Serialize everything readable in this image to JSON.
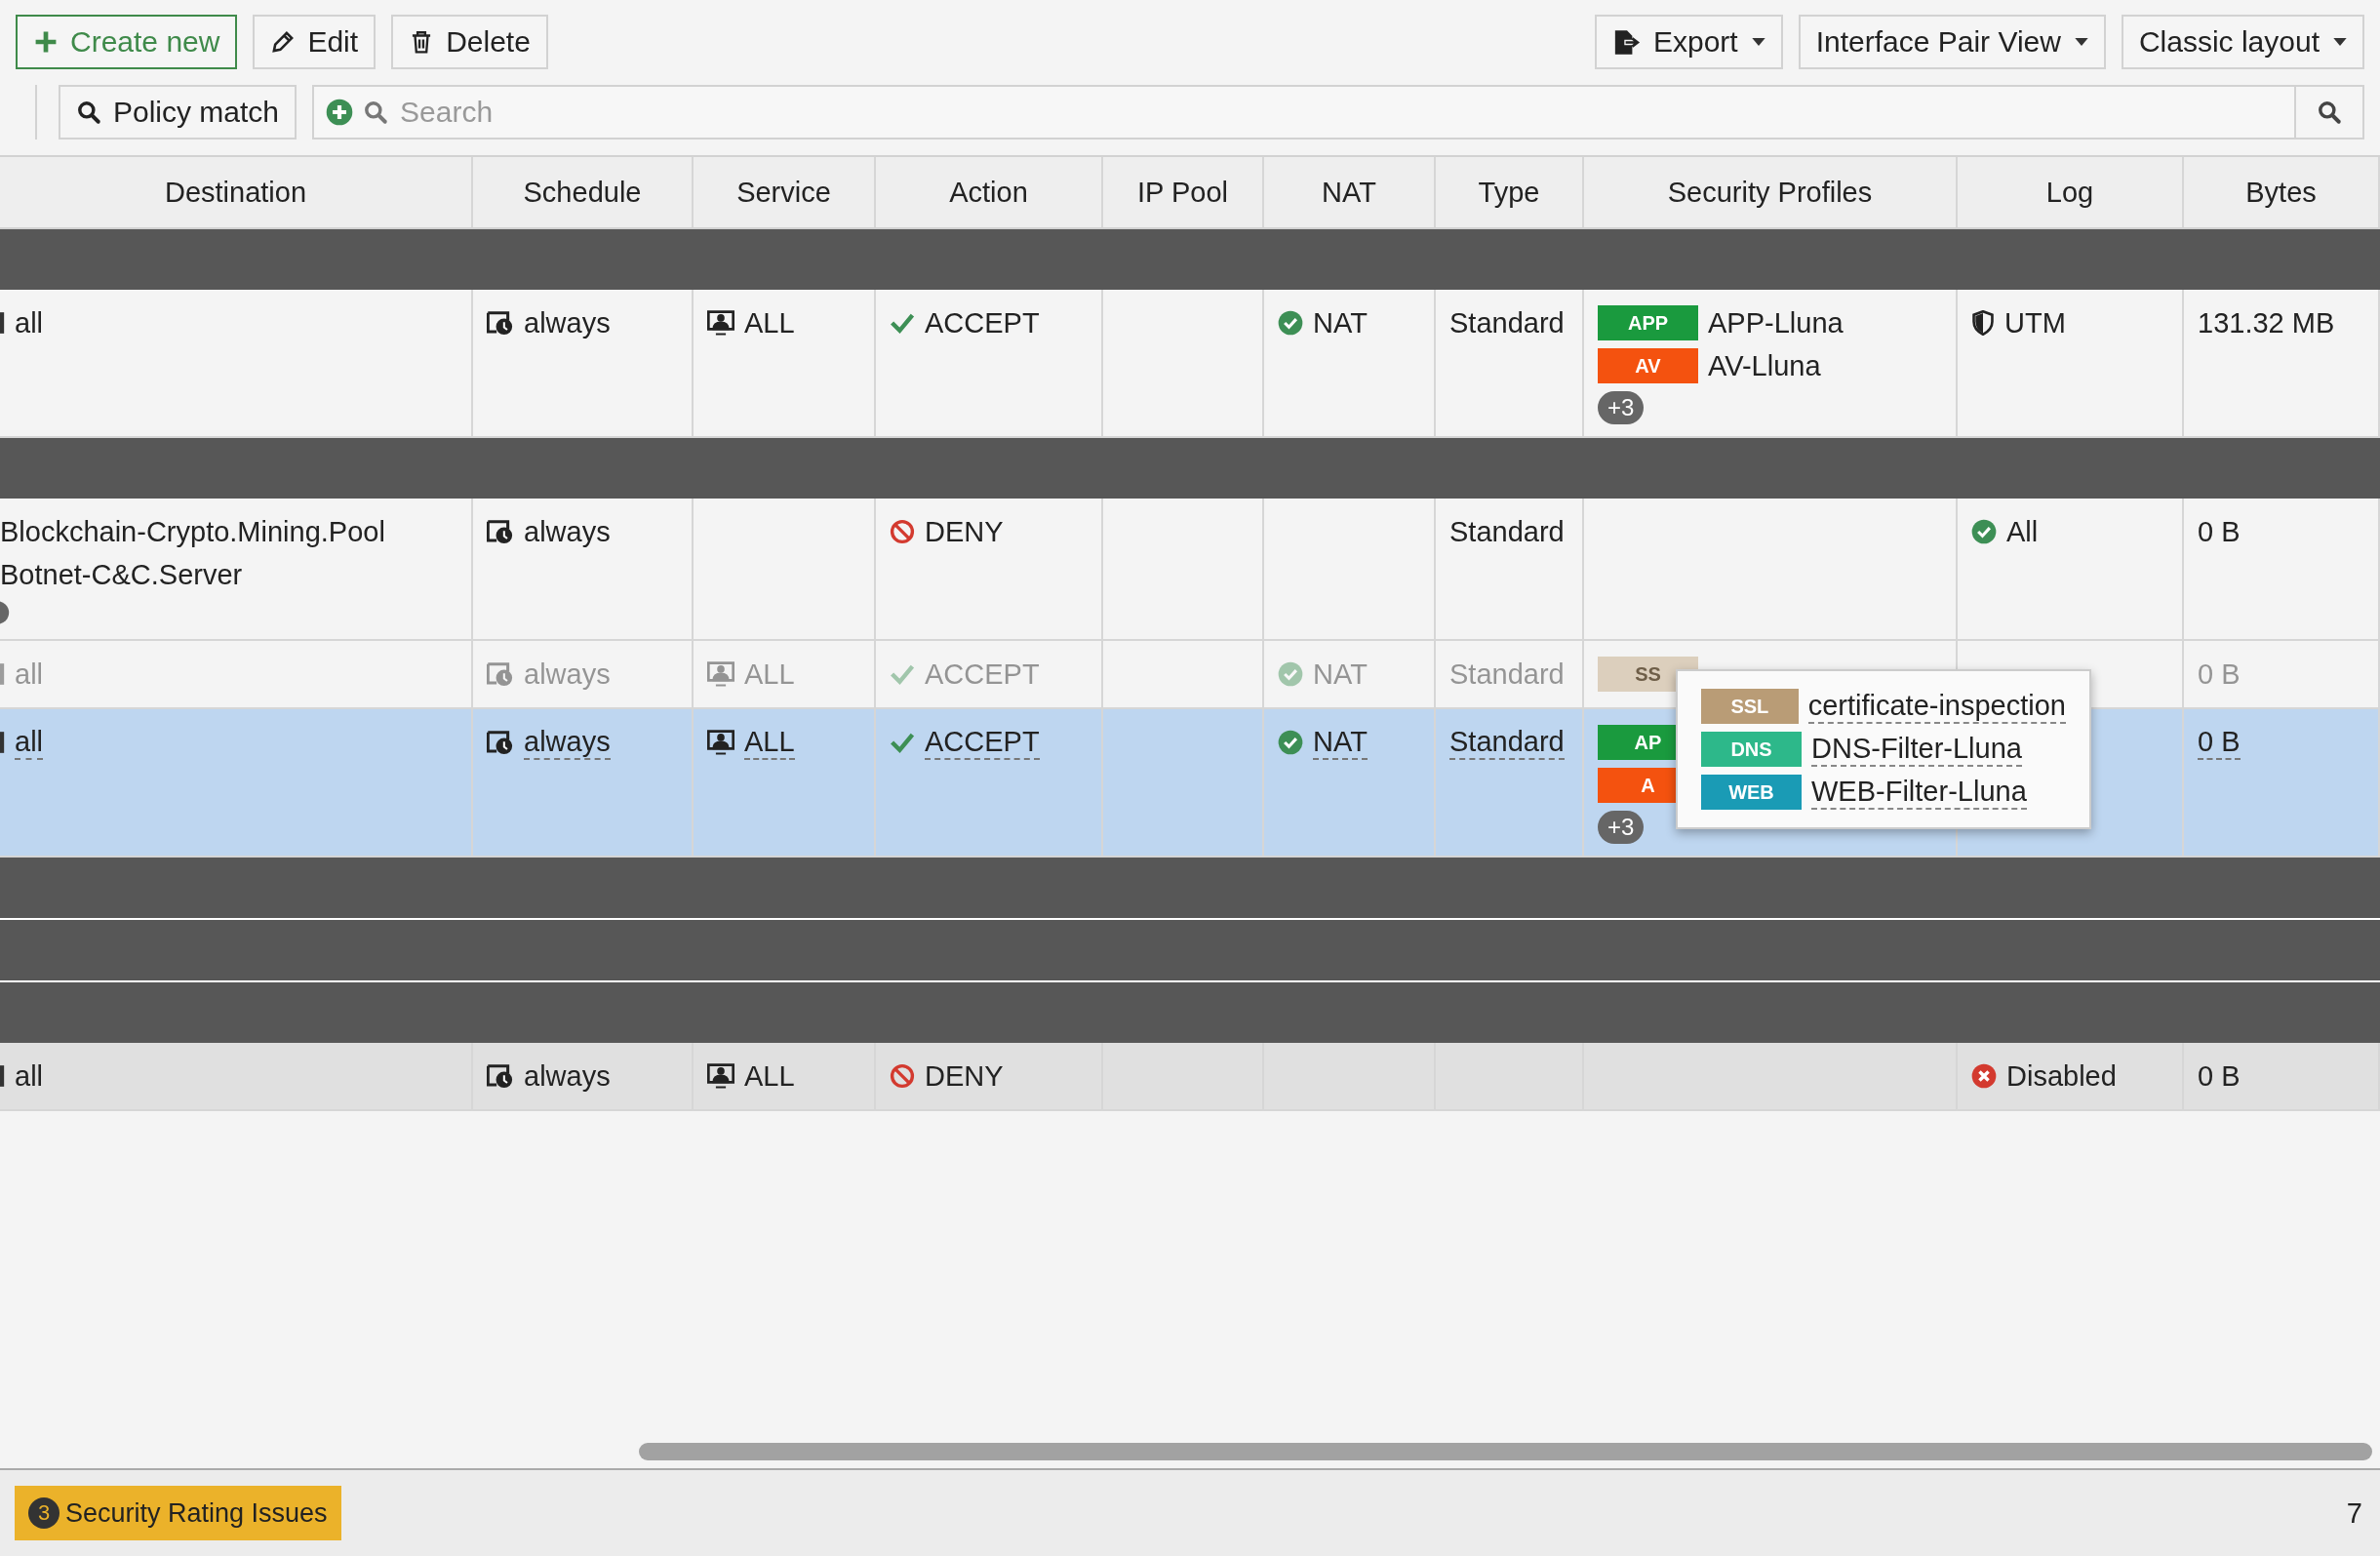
{
  "toolbar": {
    "left": [
      {
        "kind": "create",
        "label": "Create new"
      },
      {
        "kind": "edit",
        "label": "Edit"
      },
      {
        "kind": "delete",
        "label": "Delete"
      }
    ],
    "right": [
      {
        "kind": "export",
        "label": "Export"
      },
      {
        "kind": "menu",
        "label": "Interface Pair View"
      },
      {
        "kind": "menu",
        "label": "Classic layout"
      }
    ],
    "policy_match": "Policy match",
    "search": {
      "placeholder": "Search"
    }
  },
  "columns": [
    "Destination",
    "Schedule",
    "Service",
    "Action",
    "IP Pool",
    "NAT",
    "Type",
    "Security Profiles",
    "Log",
    "Bytes"
  ],
  "rows": [
    {
      "kind": "section"
    },
    {
      "kind": "policy",
      "selected": false,
      "disabled": false,
      "destination": [
        {
          "kind": "address",
          "text": "all"
        }
      ],
      "more_marker": false,
      "schedule": "always",
      "service": "ALL",
      "action": {
        "kind": "accept",
        "label": "ACCEPT"
      },
      "nat": "NAT",
      "type": "Standard",
      "profiles": [
        {
          "label": "APP",
          "name": "APP-Lluna",
          "color": "#1a9a3e"
        },
        {
          "label": "AV",
          "name": "AV-Lluna",
          "color": "#f4520f"
        }
      ],
      "more": "+3",
      "log": {
        "kind": "utm",
        "label": "UTM"
      },
      "bytes": "131.32 MB"
    },
    {
      "kind": "section"
    },
    {
      "kind": "policy",
      "selected": false,
      "disabled": false,
      "destination": [
        {
          "kind": "isdb",
          "text": "Blockchain-Crypto.Mining.Pool"
        },
        {
          "kind": "isdb",
          "text": "Botnet-C&C.Server"
        }
      ],
      "more_marker": true,
      "schedule": "always",
      "action": {
        "kind": "deny",
        "label": "DENY"
      },
      "type": "Standard",
      "log": {
        "kind": "all",
        "label": "All"
      },
      "bytes": "0 B"
    },
    {
      "kind": "policy",
      "selected": false,
      "disabled": true,
      "destination": [
        {
          "kind": "address",
          "text": "all"
        }
      ],
      "more_marker": false,
      "schedule": "always",
      "service": "ALL",
      "action": {
        "kind": "accept",
        "label": "ACCEPT"
      },
      "nat": "NAT",
      "type": "Standard",
      "profiles": [
        {
          "label": "SS",
          "color": "#dccfbd"
        }
      ],
      "bytes": "0 B"
    },
    {
      "kind": "policy",
      "selected": true,
      "disabled": false,
      "destination": [
        {
          "kind": "address",
          "text": "all"
        }
      ],
      "more_marker": false,
      "schedule": "always",
      "service": "ALL",
      "action": {
        "kind": "accept",
        "label": "ACCEPT"
      },
      "nat": "NAT",
      "type": "Standard",
      "profiles": [
        {
          "label": "AP",
          "color": "#1a9a3e"
        },
        {
          "label": "A",
          "color": "#f4520f"
        }
      ],
      "more": "+3",
      "bytes": "0 B"
    },
    {
      "kind": "section"
    },
    {
      "kind": "section"
    },
    {
      "kind": "section"
    },
    {
      "kind": "implicit",
      "selected": false,
      "disabled": false,
      "destination": [
        {
          "kind": "address",
          "text": "all"
        }
      ],
      "more_marker": false,
      "schedule": "always",
      "service": "ALL",
      "action": {
        "kind": "deny",
        "label": "DENY"
      },
      "log": {
        "kind": "disabled",
        "label": "Disabled"
      },
      "bytes": "0 B"
    }
  ],
  "tooltip": {
    "items": [
      {
        "label": "SSL",
        "name": "certificate-inspection",
        "color": "#b99c76"
      },
      {
        "label": "DNS",
        "name": "DNS-Filter-Lluna",
        "color": "#2db88a"
      },
      {
        "label": "WEB",
        "name": "WEB-Filter-Lluna",
        "color": "#1a9bb5"
      }
    ]
  },
  "status_bar": {
    "issues": {
      "count": "3",
      "label": "Security Rating Issues"
    },
    "total": "7"
  }
}
